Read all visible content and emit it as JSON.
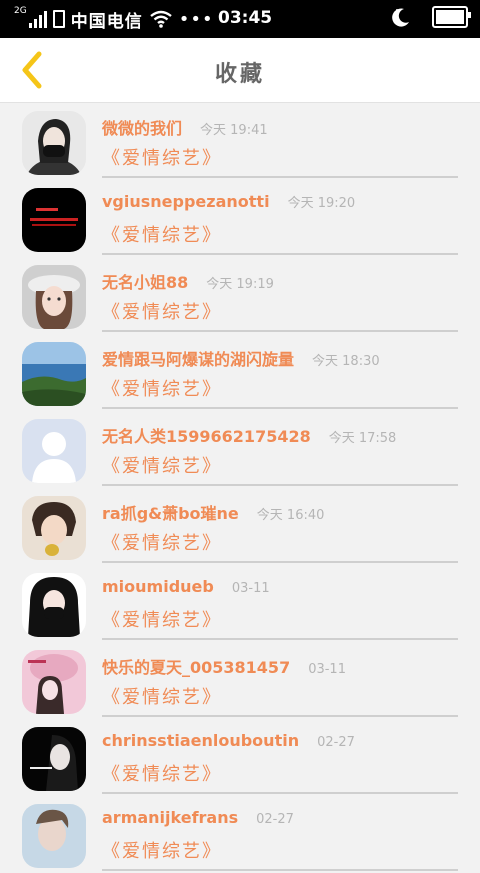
{
  "status_bar": {
    "network": "2G",
    "carrier": "中国电信",
    "dots": "•••",
    "time": "03:45"
  },
  "header": {
    "title": "收藏",
    "back_icon": "chevron-left-icon",
    "accent": "#f5c518"
  },
  "colors": {
    "name": "#f08b55",
    "time": "#b5b5b5"
  },
  "items": [
    {
      "name": "微微的我们",
      "time": "今天 19:41",
      "subtitle": "《爱情综艺》",
      "avatar": "girl-portrait"
    },
    {
      "name": "vgiusneppezanotti",
      "time": "今天 19:20",
      "subtitle": "《爱情综艺》",
      "avatar": "red-text-banner"
    },
    {
      "name": "无名小姐88",
      "time": "今天 19:19",
      "subtitle": "《爱情综艺》",
      "avatar": "girl-with-hat"
    },
    {
      "name": "爱情跟马阿爆谋的湖闪旋量",
      "time": "今天 18:30",
      "subtitle": "《爱情综艺》",
      "avatar": "coastal-landscape"
    },
    {
      "name": "无名人类1599662175428",
      "time": "今天 17:58",
      "subtitle": "《爱情综艺》",
      "avatar": "default-user"
    },
    {
      "name": "ra抓g&萧bo璀ne",
      "time": "今天 16:40",
      "subtitle": "《爱情综艺》",
      "avatar": "child-photo"
    },
    {
      "name": "mioumidueb",
      "time": "03-11",
      "subtitle": "《爱情综艺》",
      "avatar": "dark-hair-girl"
    },
    {
      "name": "快乐的夏天_005381457",
      "time": "03-11",
      "subtitle": "《爱情综艺》",
      "avatar": "pink-girls"
    },
    {
      "name": "chrinsstiaenlouboutin",
      "time": "02-27",
      "subtitle": "《爱情综艺》",
      "avatar": "smoking-girl"
    },
    {
      "name": "armanijkefrans",
      "time": "02-27",
      "subtitle": "《爱情综艺》",
      "avatar": "blue-portrait"
    }
  ]
}
